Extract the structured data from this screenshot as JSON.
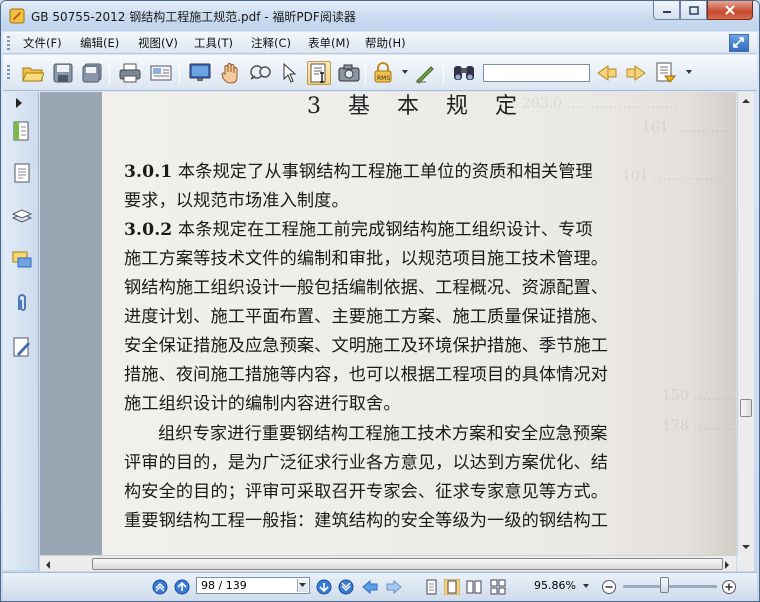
{
  "window": {
    "title": "GB 50755-2012 钢结构工程施工规范.pdf - 福昕PDF阅读器"
  },
  "menu": {
    "items": [
      "文件(F)",
      "编辑(E)",
      "视图(V)",
      "工具(T)",
      "注释(C)",
      "表单(M)",
      "帮助(H)"
    ]
  },
  "toolbar": {
    "search_value": "",
    "icons": [
      "open-folder-icon",
      "save-icon",
      "save-all-icon",
      "print-icon",
      "email-icon",
      "fullscreen-icon",
      "hand-tool-icon",
      "zoom-glass-icon",
      "select-arrow-icon",
      "text-select-icon",
      "snapshot-icon",
      "rms-lock-icon",
      "sign-icon",
      "find-binoculars-icon",
      "find-prev-icon",
      "find-next-icon",
      "highlight-icon"
    ]
  },
  "document": {
    "chapter_heading": "3  基 本 规 定",
    "lines": [
      {
        "num": "3.0.1",
        "text": "  本条规定了从事钢结构工程施工单位的资质和相关管理"
      },
      {
        "num": "",
        "text": "要求，以规范市场准入制度。"
      },
      {
        "num": "3.0.2",
        "text": "  本条规定在工程施工前完成钢结构施工组织设计、专项"
      },
      {
        "num": "",
        "text": "施工方案等技术文件的编制和审批，以规范项目施工技术管理。"
      },
      {
        "num": "",
        "text": "钢结构施工组织设计一般包括编制依据、工程概况、资源配置、"
      },
      {
        "num": "",
        "text": "进度计划、施工平面布置、主要施工方案、施工质量保证措施、"
      },
      {
        "num": "",
        "text": "安全保证措施及应急预案、文明施工及环境保护措施、季节施工"
      },
      {
        "num": "",
        "text": "措施、夜间施工措施等内容，也可以根据工程项目的具体情况对"
      },
      {
        "num": "",
        "text": "施工组织设计的编制内容进行取舍。"
      },
      {
        "num": "",
        "text": "组织专家进行重要钢结构工程施工技术方案和安全应急预案",
        "indent": true
      },
      {
        "num": "",
        "text": "评审的目的，是为广泛征求行业各方意见，以达到方案优化、结"
      },
      {
        "num": "",
        "text": "构安全的目的；评审可采取召开专家会、征求专家意见等方式。"
      },
      {
        "num": "",
        "text": "重要钢结构工程一般指：建筑结构的安全等级为一级的钢结构工"
      }
    ]
  },
  "status": {
    "page_display": "98 / 139",
    "zoom": "95.86%",
    "zoom_fraction": 0.42
  },
  "colors": {
    "chrome": "#cfdcec",
    "page": "#efeeea",
    "accent": "#2f6bc0"
  }
}
